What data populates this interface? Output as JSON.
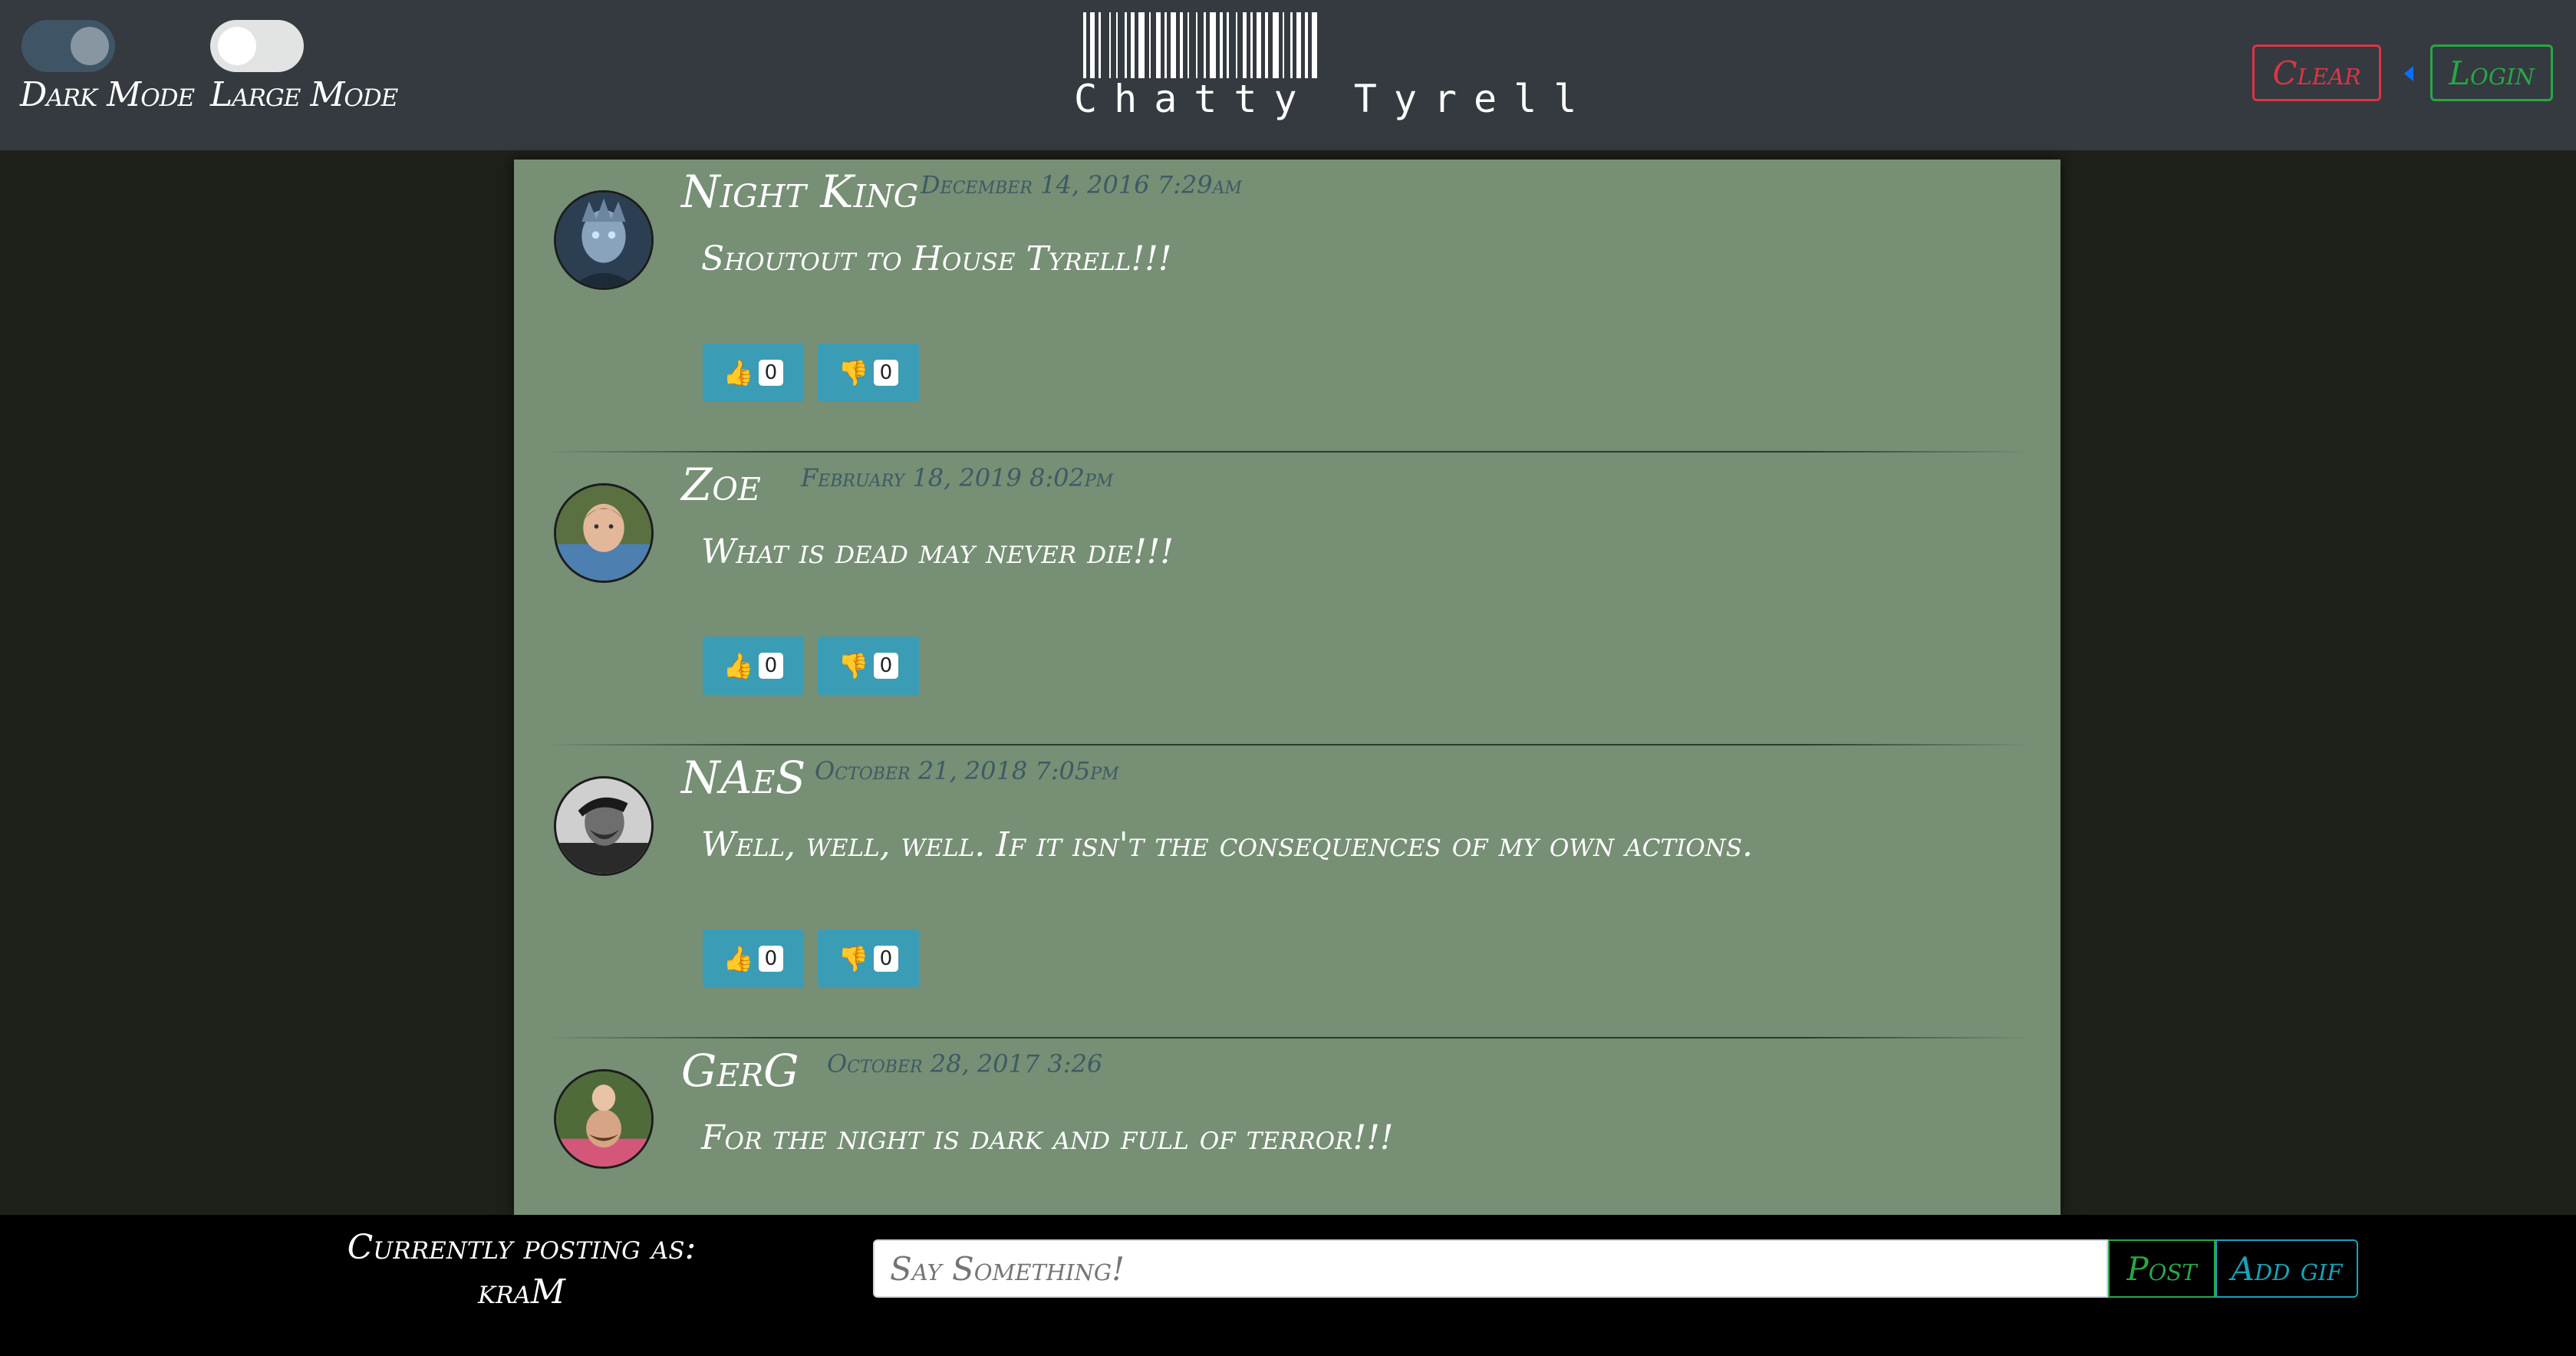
{
  "header": {
    "toggles": [
      {
        "label": "Dark Mode",
        "state": "on"
      },
      {
        "label": "Large Mode",
        "state": "off"
      }
    ],
    "brand": "Chatty Tyrell",
    "clear_label": "Clear",
    "login_label": "Login"
  },
  "posts": [
    {
      "name": "Night King",
      "date": "December 14, 2016 7:29am",
      "message": "Shoutout to House Tyrell!!!",
      "likes": "0",
      "dislikes": "0"
    },
    {
      "name": "Zoe",
      "date": "February 18, 2019 8:02pm",
      "message": "What is dead may never die!!!",
      "likes": "0",
      "dislikes": "0"
    },
    {
      "name": "NAeS",
      "date": "October 21, 2018 7:05pm",
      "message": "Well, well, well. If it isn't the consequences of my own actions.",
      "likes": "0",
      "dislikes": "0"
    },
    {
      "name": "GerG",
      "date": "October 28, 2017 3:26",
      "message": "For the night is dark and full of terror!!!",
      "likes": "",
      "dislikes": ""
    }
  ],
  "footer": {
    "posting_as_label": "Currently posting as:",
    "username": "kraM",
    "input_placeholder": "Say Something!",
    "post_label": "Post",
    "gif_label": "Add gif"
  },
  "colors": {
    "header_bg": "#343a40",
    "feed_bg": "#768f75",
    "vote_bg": "#3b9cb5",
    "clear": "#dc3545",
    "login": "#28a745",
    "gif": "#17a2b8"
  }
}
